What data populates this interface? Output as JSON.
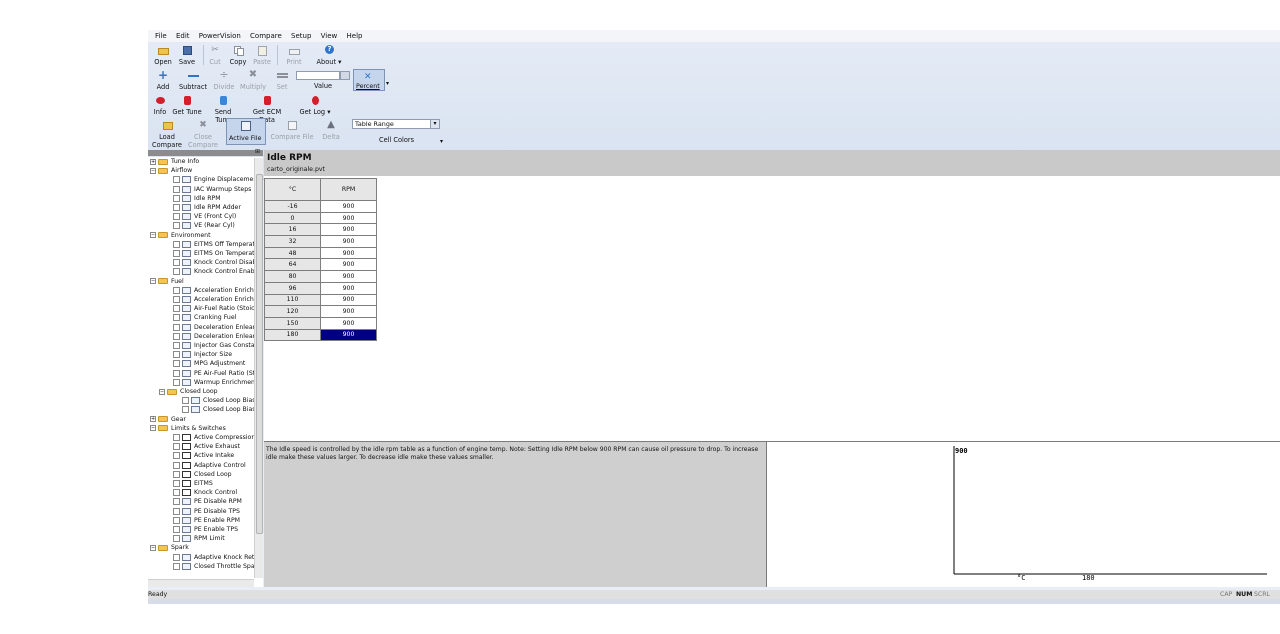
{
  "menu": [
    "File",
    "Edit",
    "PowerVision",
    "Compare",
    "Setup",
    "View",
    "Help"
  ],
  "toolbar": {
    "row1": [
      {
        "label": "Open",
        "icon": "folder-icon",
        "enabled": true
      },
      {
        "label": "Save",
        "icon": "save-icon",
        "enabled": true
      },
      {
        "label": "Cut",
        "icon": "cut-icon",
        "enabled": false
      },
      {
        "label": "Copy",
        "icon": "copy-icon",
        "enabled": true
      },
      {
        "label": "Paste",
        "icon": "paste-icon",
        "enabled": false
      },
      {
        "label": "Print",
        "icon": "print-icon",
        "enabled": false
      },
      {
        "label": "About",
        "icon": "help-icon",
        "enabled": true,
        "dropdown": "▾"
      }
    ],
    "row2": [
      {
        "label": "Add",
        "icon": "plus-icon",
        "enabled": true
      },
      {
        "label": "Subtract",
        "icon": "minus-icon",
        "enabled": true
      },
      {
        "label": "Divide",
        "icon": "divide-icon",
        "enabled": false
      },
      {
        "label": "Multiply",
        "icon": "multiply-icon",
        "enabled": false
      },
      {
        "label": "Set",
        "icon": "equals-icon",
        "enabled": false
      }
    ],
    "value_label": "Value",
    "value_input": "",
    "percent_label": "Percent",
    "row3": [
      {
        "label": "Info",
        "icon": "info-icon"
      },
      {
        "label": "Get Tune",
        "icon": "get-tune-icon"
      },
      {
        "label": "Send Tune",
        "icon": "send-tune-icon"
      },
      {
        "label": "Get ECM Data",
        "icon": "ecm-data-icon"
      },
      {
        "label": "Get Log",
        "icon": "log-icon",
        "dropdown": "▾"
      }
    ],
    "row4": [
      {
        "label": "Load\nCompare",
        "icon": "load-compare-icon",
        "enabled": true
      },
      {
        "label": "Close\nCompare",
        "icon": "close-compare-icon",
        "enabled": false
      },
      {
        "label": "Active File",
        "icon": "active-file-icon",
        "enabled": true
      },
      {
        "label": "Compare File",
        "icon": "compare-file-icon",
        "enabled": false
      },
      {
        "label": "Delta",
        "icon": "delta-icon",
        "enabled": false
      }
    ],
    "table_range_value": "Table Range",
    "cell_colors_label": "Cell Colors"
  },
  "tree": [
    {
      "label": "Tune Info",
      "level": 0,
      "type": "folder",
      "expander": "+"
    },
    {
      "label": "Airflow",
      "level": 0,
      "type": "folder",
      "expander": "−"
    },
    {
      "label": "Engine Displacement",
      "level": 1,
      "type": "leaf"
    },
    {
      "label": "IAC Warmup Steps",
      "level": 1,
      "type": "leaf"
    },
    {
      "label": "Idle RPM",
      "level": 1,
      "type": "leaf"
    },
    {
      "label": "Idle RPM Adder",
      "level": 1,
      "type": "leaf"
    },
    {
      "label": "VE (Front Cyl)",
      "level": 1,
      "type": "leaf"
    },
    {
      "label": "VE (Rear Cyl)",
      "level": 1,
      "type": "leaf"
    },
    {
      "label": "Environment",
      "level": 0,
      "type": "folder",
      "expander": "−"
    },
    {
      "label": "EITMS Off Temperatur",
      "level": 1,
      "type": "leaf"
    },
    {
      "label": "EITMS On Temperaturi",
      "level": 1,
      "type": "leaf"
    },
    {
      "label": "Knock Control Disable T",
      "level": 1,
      "type": "leaf"
    },
    {
      "label": "Knock Control Enable T",
      "level": 1,
      "type": "leaf"
    },
    {
      "label": "Fuel",
      "level": 0,
      "type": "folder",
      "expander": "−"
    },
    {
      "label": "Acceleration Enrichmer",
      "level": 1,
      "type": "leaf"
    },
    {
      "label": "Acceleration Enrichmer",
      "level": 1,
      "type": "leaf"
    },
    {
      "label": "Air-Fuel Ratio (Stoich)",
      "level": 1,
      "type": "leaf"
    },
    {
      "label": "Cranking Fuel",
      "level": 1,
      "type": "leaf"
    },
    {
      "label": "Deceleration Enleanme",
      "level": 1,
      "type": "leaf"
    },
    {
      "label": "Deceleration Enleanme",
      "level": 1,
      "type": "leaf"
    },
    {
      "label": "Injector Gas Constant",
      "level": 1,
      "type": "leaf"
    },
    {
      "label": "Injector Size",
      "level": 1,
      "type": "leaf"
    },
    {
      "label": "MPG Adjustment",
      "level": 1,
      "type": "leaf"
    },
    {
      "label": "PE Air-Fuel Ratio (Stoic",
      "level": 1,
      "type": "leaf"
    },
    {
      "label": "Warmup Enrichment (S",
      "level": 1,
      "type": "leaf"
    },
    {
      "label": "Closed Loop",
      "level": 1,
      "type": "folder",
      "expander": "−"
    },
    {
      "label": "Closed Loop Bias (I",
      "level": 2,
      "type": "leaf"
    },
    {
      "label": "Closed Loop Bias (I",
      "level": 2,
      "type": "leaf"
    },
    {
      "label": "Gear",
      "level": 0,
      "type": "folder",
      "expander": "+"
    },
    {
      "label": "Limits & Switches",
      "level": 0,
      "type": "folder",
      "expander": "−"
    },
    {
      "label": "Active Compression Re",
      "level": 1,
      "type": "switch"
    },
    {
      "label": "Active Exhaust",
      "level": 1,
      "type": "switch"
    },
    {
      "label": "Active Intake",
      "level": 1,
      "type": "switch"
    },
    {
      "label": "Adaptive Control",
      "level": 1,
      "type": "switch"
    },
    {
      "label": "Closed Loop",
      "level": 1,
      "type": "switch"
    },
    {
      "label": "EITMS",
      "level": 1,
      "type": "switch"
    },
    {
      "label": "Knock Control",
      "level": 1,
      "type": "switch"
    },
    {
      "label": "PE Disable RPM",
      "level": 1,
      "type": "leaf"
    },
    {
      "label": "PE Disable TPS",
      "level": 1,
      "type": "leaf"
    },
    {
      "label": "PE Enable RPM",
      "level": 1,
      "type": "leaf"
    },
    {
      "label": "PE Enable TPS",
      "level": 1,
      "type": "leaf"
    },
    {
      "label": "RPM Limit",
      "level": 1,
      "type": "leaf"
    },
    {
      "label": "Spark",
      "level": 0,
      "type": "folder",
      "expander": "−"
    },
    {
      "label": "Adaptive Knock Retarc",
      "level": 1,
      "type": "leaf"
    },
    {
      "label": "Closed Throttle Spark",
      "level": 1,
      "type": "leaf"
    }
  ],
  "editor": {
    "title": "Idle RPM",
    "file": "carto_originale.pvt",
    "col_header_x": "°C",
    "col_header_y": "RPM",
    "rows": [
      {
        "c": "-16",
        "rpm": "900"
      },
      {
        "c": "0",
        "rpm": "900"
      },
      {
        "c": "16",
        "rpm": "900"
      },
      {
        "c": "32",
        "rpm": "900"
      },
      {
        "c": "48",
        "rpm": "900"
      },
      {
        "c": "64",
        "rpm": "900"
      },
      {
        "c": "80",
        "rpm": "900"
      },
      {
        "c": "96",
        "rpm": "900"
      },
      {
        "c": "110",
        "rpm": "900"
      },
      {
        "c": "120",
        "rpm": "900"
      },
      {
        "c": "150",
        "rpm": "900"
      },
      {
        "c": "180",
        "rpm": "900"
      }
    ],
    "selected_row": 11,
    "description": "The Idle speed is controlled by the idle rpm table as a function of engine temp.  Note: Setting Idle RPM below 900 RPM can cause oil pressure to drop. To increase idle make these values larger. To decrease idle make these values smaller."
  },
  "chart_data": {
    "type": "line",
    "title": "",
    "y_value_label": "900",
    "x_unit_label": "°C",
    "x_value_label": "180"
  },
  "status": {
    "left": "Ready",
    "indicators": [
      "CAP",
      "NUM",
      "SCRL"
    ]
  },
  "colors": {
    "selection": "#000080",
    "ribbon": "#dbe4f2",
    "panel_gray": "#c9c9c9"
  }
}
